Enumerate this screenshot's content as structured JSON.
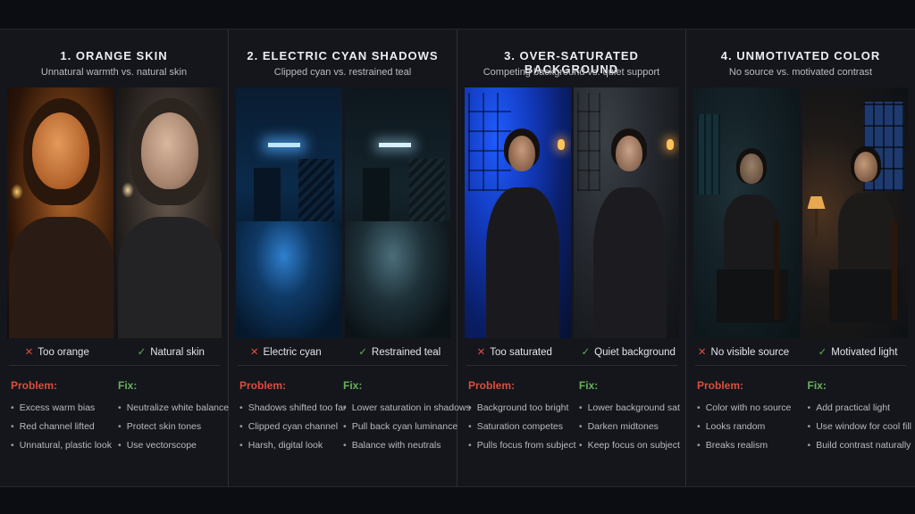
{
  "panels": [
    {
      "title": "1. ORANGE SKIN",
      "subtitle": "Unnatural warmth vs. natural skin",
      "bad_label": "Too orange",
      "good_label": "Natural skin",
      "problem_heading": "Problem:",
      "fix_heading": "Fix:",
      "problems": [
        "Excess warm bias",
        "Red channel lifted",
        "Unnatural, plastic look"
      ],
      "fixes": [
        "Neutralize white balance",
        "Protect skin tones",
        "Use vectorscope"
      ]
    },
    {
      "title": "2. ELECTRIC CYAN SHADOWS",
      "subtitle": "Clipped cyan vs. restrained teal",
      "bad_label": "Electric cyan",
      "good_label": "Restrained teal",
      "problem_heading": "Problem:",
      "fix_heading": "Fix:",
      "problems": [
        "Shadows shifted too far",
        "Clipped cyan channel",
        "Harsh, digital look"
      ],
      "fixes": [
        "Lower saturation in shadows",
        "Pull back cyan luminance",
        "Balance with neutrals"
      ]
    },
    {
      "title": "3. OVER-SATURATED BACKGROUND",
      "subtitle": "Competing background vs. quiet support",
      "bad_label": "Too saturated",
      "good_label": "Quiet background",
      "problem_heading": "Problem:",
      "fix_heading": "Fix:",
      "problems": [
        "Background too bright",
        "Saturation competes",
        "Pulls focus from subject"
      ],
      "fixes": [
        "Lower background sat",
        "Darken midtones",
        "Keep focus on subject"
      ]
    },
    {
      "title": "4. UNMOTIVATED COLOR",
      "subtitle": "No source vs. motivated contrast",
      "bad_label": "No visible source",
      "good_label": "Motivated light",
      "problem_heading": "Problem:",
      "fix_heading": "Fix:",
      "problems": [
        "Color with no source",
        "Looks random",
        "Breaks realism"
      ],
      "fixes": [
        "Add practical light",
        "Use window for cool fill",
        "Build contrast naturally"
      ]
    }
  ],
  "icons": {
    "bad": "cross-icon",
    "good": "check-icon"
  },
  "colors": {
    "problem": "#d8503c",
    "fix": "#67b25a",
    "background": "#14161c"
  }
}
